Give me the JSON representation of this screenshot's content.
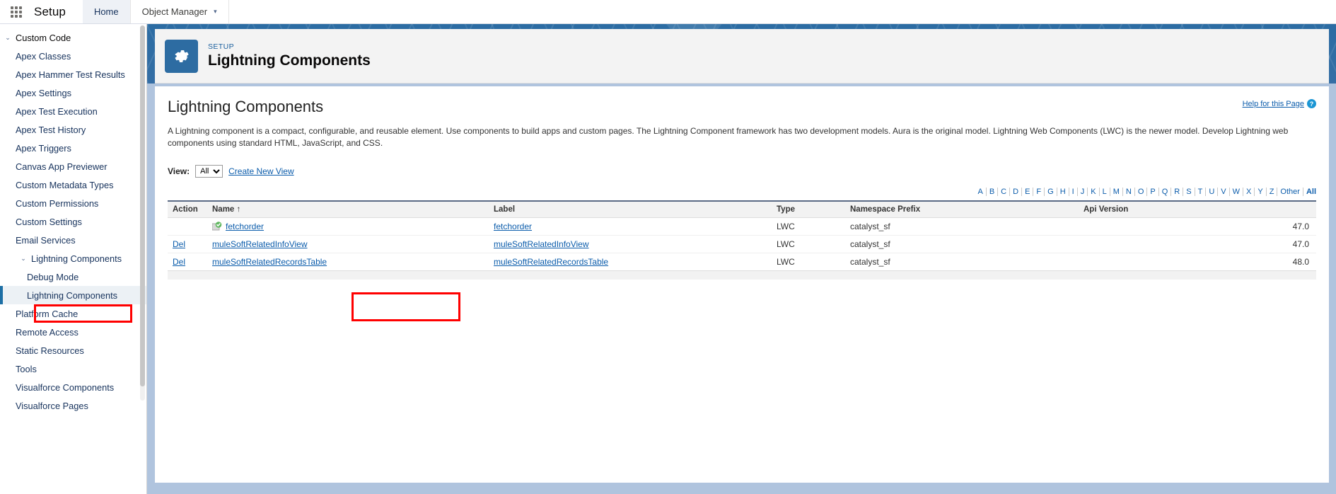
{
  "global_header": {
    "app_launcher_icon": "app-launcher-grid-icon",
    "product": "Setup",
    "tabs": [
      {
        "label": "Home",
        "active": true
      },
      {
        "label": "Object Manager",
        "active": false,
        "chevron": "▾"
      }
    ]
  },
  "sidebar": {
    "items": [
      {
        "label": "Custom Code",
        "level": 0,
        "expanded": true,
        "twisty": "⌄"
      },
      {
        "label": "Apex Classes",
        "level": 1
      },
      {
        "label": "Apex Hammer Test Results",
        "level": 1
      },
      {
        "label": "Apex Settings",
        "level": 1
      },
      {
        "label": "Apex Test Execution",
        "level": 1
      },
      {
        "label": "Apex Test History",
        "level": 1
      },
      {
        "label": "Apex Triggers",
        "level": 1
      },
      {
        "label": "Canvas App Previewer",
        "level": 1
      },
      {
        "label": "Custom Metadata Types",
        "level": 1
      },
      {
        "label": "Custom Permissions",
        "level": 1
      },
      {
        "label": "Custom Settings",
        "level": 1
      },
      {
        "label": "Email Services",
        "level": 1
      },
      {
        "label": "Lightning Components",
        "level": 1,
        "expanded": true,
        "twisty": "⌄"
      },
      {
        "label": "Debug Mode",
        "level": 2
      },
      {
        "label": "Lightning Components",
        "level": 2,
        "selected": true
      },
      {
        "label": "Platform Cache",
        "level": 1
      },
      {
        "label": "Remote Access",
        "level": 1
      },
      {
        "label": "Static Resources",
        "level": 1
      },
      {
        "label": "Tools",
        "level": 1
      },
      {
        "label": "Visualforce Components",
        "level": 1
      },
      {
        "label": "Visualforce Pages",
        "level": 1
      }
    ]
  },
  "banner": {
    "icon": "gear-icon",
    "eyebrow": "SETUP",
    "title": "Lightning Components"
  },
  "content": {
    "title": "Lightning Components",
    "description": "A Lightning component is a compact, configurable, and reusable element. Use components to build apps and custom pages. The Lightning Component framework has two development models. Aura is the original model. Lightning Web Components (LWC) is the newer model. Develop Lightning web components using standard HTML, JavaScript, and CSS.",
    "help_link": "Help for this Page",
    "help_icon": "question-mark-icon",
    "view_label": "View:",
    "view_value": "All",
    "view_options": [
      "All"
    ],
    "create_new_view": "Create New View",
    "alphabet": [
      "A",
      "B",
      "C",
      "D",
      "E",
      "F",
      "G",
      "H",
      "I",
      "J",
      "K",
      "L",
      "M",
      "N",
      "O",
      "P",
      "Q",
      "R",
      "S",
      "T",
      "U",
      "V",
      "W",
      "X",
      "Y",
      "Z",
      "Other",
      "All"
    ]
  },
  "table": {
    "columns": [
      "Action",
      "Name",
      "Label",
      "Type",
      "Namespace Prefix",
      "Api Version"
    ],
    "sort_column": "Name",
    "sort_indicator": "↑",
    "rows": [
      {
        "action": "",
        "has_package_icon": true,
        "name": "fetchorder",
        "label": "fetchorder",
        "type": "LWC",
        "namespace_prefix": "catalyst_sf",
        "api_version": "47.0"
      },
      {
        "action": "Del",
        "has_package_icon": false,
        "name": "muleSoftRelatedInfoView",
        "label": "muleSoftRelatedInfoView",
        "type": "LWC",
        "namespace_prefix": "catalyst_sf",
        "api_version": "47.0"
      },
      {
        "action": "Del",
        "has_package_icon": false,
        "name": "muleSoftRelatedRecordsTable",
        "label": "muleSoftRelatedRecordsTable",
        "type": "LWC",
        "namespace_prefix": "catalyst_sf",
        "api_version": "48.0"
      }
    ]
  },
  "annotations": {
    "color": "#ff0000",
    "boxes": [
      {
        "name": "sidebar-lightning-components-highlight"
      },
      {
        "name": "table-name-cells-highlight"
      }
    ]
  }
}
